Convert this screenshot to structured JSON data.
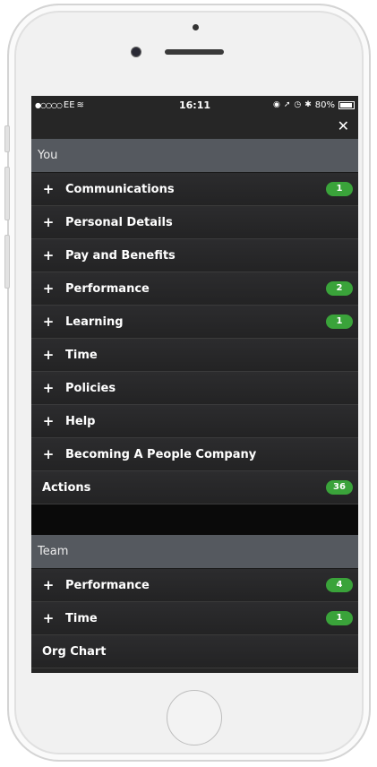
{
  "status": {
    "carrier": "EE",
    "time": "16:11",
    "battery": "80%"
  },
  "close_icon": "✕",
  "you": {
    "header": "You",
    "items": [
      {
        "label": "Communications",
        "badge": "1"
      },
      {
        "label": "Personal Details",
        "badge": null
      },
      {
        "label": "Pay and Benefits",
        "badge": null
      },
      {
        "label": "Performance",
        "badge": "2"
      },
      {
        "label": "Learning",
        "badge": "1"
      },
      {
        "label": "Time",
        "badge": null
      },
      {
        "label": "Policies",
        "badge": null
      },
      {
        "label": "Help",
        "badge": null
      },
      {
        "label": "Becoming A People Company",
        "badge": null
      }
    ],
    "actions": {
      "label": "Actions",
      "badge": "36"
    }
  },
  "team": {
    "header": "Team",
    "items": [
      {
        "label": "Performance",
        "badge": "4"
      },
      {
        "label": "Time",
        "badge": "1"
      }
    ],
    "org_chart": {
      "label": "Org Chart"
    }
  },
  "colors": {
    "badge": "#3aa33a",
    "header_bg": "#55595f",
    "menu_bg": "#262626"
  }
}
